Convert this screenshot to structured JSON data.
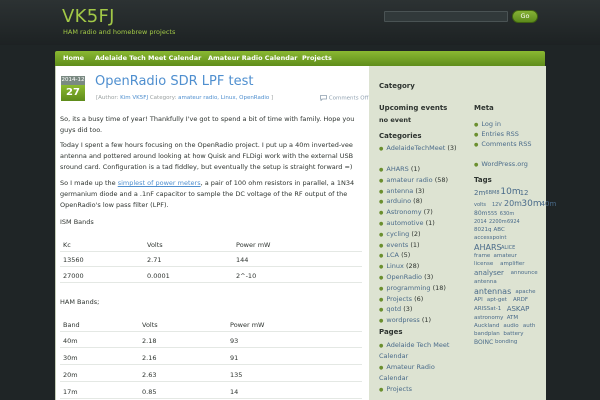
{
  "header": {
    "site_title": "VK5FJ",
    "tagline": "HAM radio and homebrew projects",
    "search_button": "Go"
  },
  "nav": {
    "items": [
      "Home",
      "Adelaide Tech Meet Calendar",
      "Amateur Radio Calendar",
      "Projects"
    ]
  },
  "post": {
    "date_month": "2014-12",
    "date_day": "27",
    "title": "OpenRadio SDR LPF test",
    "meta_author_prefix": "[Author: ",
    "meta_author": "Kim VK5FJ",
    "meta_category_prefix": " Category: ",
    "meta_categories": "amateur radio, Linux, OpenRadio",
    "meta_suffix": " ]",
    "comments": "Comments Off",
    "p1": "So, its a busy time of year! Thankfully I've got to spend a bit of time with family. Hope you guys did too.",
    "p2": "Today I spent a few hours focusing on the OpenRadio project. I put up a 40m inverted-vee antenna and pottered around looking at how Quisk and FLDigi work with the external USB sround card. Configuration is a tad fiddley, but eventually the setup is straight forward =)",
    "p3_before": "So I made up the ",
    "p3_link": "simplest of power meters",
    "p3_after": ", a pair of 100 ohm resistors in parallel, a 1N34 germanium diode and a .1nF capacitor to sample the DC voltage of the RF output of the OpenRadio's low pass filter (LPF).",
    "ism_label": "ISM Bands",
    "ism_headers": [
      "Kc",
      "Volts",
      "Power mW"
    ],
    "ism_rows": [
      [
        "13560",
        "2.71",
        "144"
      ],
      [
        "27000",
        "0.0001",
        "2^-10"
      ]
    ],
    "ham_label": "HAM Bands;",
    "ham_headers": [
      "Band",
      "Volts",
      "Power mW"
    ],
    "ham_rows": [
      [
        "40m",
        "2.18",
        "93"
      ],
      [
        "30m",
        "2.16",
        "91"
      ],
      [
        "20m",
        "2.63",
        "135"
      ],
      [
        "17m",
        "0.85",
        "14"
      ]
    ]
  },
  "sidebar": {
    "category_title": "Category",
    "upcoming_title": "Upcoming events",
    "no_event": "no event",
    "meta_title": "Meta",
    "meta_links": [
      "Log in",
      "Entries RSS",
      "Comments RSS",
      "WordPress.org"
    ],
    "categories_title": "Categories",
    "categories": [
      {
        "name": "AdelaideTechMeet",
        "count": "(3)"
      },
      {
        "name": "AHARS",
        "count": "(1)"
      },
      {
        "name": "amateur radio",
        "count": "(58)"
      },
      {
        "name": "antenna",
        "count": "(3)"
      },
      {
        "name": "arduino",
        "count": "(8)"
      },
      {
        "name": "Astronomy",
        "count": "(7)"
      },
      {
        "name": "automotive",
        "count": "(1)"
      },
      {
        "name": "cycling",
        "count": "(2)"
      },
      {
        "name": "events",
        "count": "(1)"
      },
      {
        "name": "LCA",
        "count": "(5)"
      },
      {
        "name": "Linux",
        "count": "(28)"
      },
      {
        "name": "OpenRadio",
        "count": "(3)"
      },
      {
        "name": "programming",
        "count": "(18)"
      },
      {
        "name": "Projects",
        "count": "(6)"
      },
      {
        "name": "qotd",
        "count": "(3)"
      },
      {
        "name": "wordpress",
        "count": "(1)"
      }
    ],
    "tags_title": "Tags",
    "tag_lines": [
      [
        {
          "t": "2m",
          "s": 7
        },
        {
          "t": "6BM8",
          "s": 5
        },
        {
          "t": "10m",
          "s": 9
        },
        {
          "t": "12",
          "s": 7
        }
      ],
      [
        {
          "t": "volts",
          "s": 5
        },
        {
          "t": "12V",
          "s": 5
        },
        {
          "t": "20m",
          "s": 8
        },
        {
          "t": "30m",
          "s": 9
        },
        {
          "t": "40m",
          "s": 7
        }
      ],
      [
        {
          "t": "80m",
          "s": 6
        },
        {
          "t": "555",
          "s": 5
        },
        {
          "t": "630m",
          "s": 5
        }
      ],
      [
        {
          "t": "2014",
          "s": 5
        },
        {
          "t": "2200m",
          "s": 5
        },
        {
          "t": "6924",
          "s": 5
        }
      ],
      [
        {
          "t": "8021q",
          "s": 5.5
        },
        {
          "t": "ABC",
          "s": 5.5
        }
      ],
      [
        {
          "t": "accesspoint",
          "s": 5.5
        }
      ],
      [
        {
          "t": "AHARS",
          "s": 8
        },
        {
          "t": "ALICE",
          "s": 5
        }
      ],
      [
        {
          "t": "frame",
          "s": 5.5
        },
        {
          "t": "amateur",
          "s": 5.5
        }
      ],
      [
        {
          "t": "license",
          "s": 5.5
        },
        {
          "t": "amplifier",
          "s": 5.5
        }
      ],
      [
        {
          "t": "analyser",
          "s": 7
        },
        {
          "t": "announce",
          "s": 5.5
        }
      ],
      [
        {
          "t": "antenna",
          "s": 5.5
        }
      ],
      [
        {
          "t": "antennas",
          "s": 8
        },
        {
          "t": "apache",
          "s": 5.5
        }
      ],
      [
        {
          "t": "API",
          "s": 5.5
        },
        {
          "t": "apt-get",
          "s": 5.5
        },
        {
          "t": "ARDF",
          "s": 5.5
        }
      ],
      [
        {
          "t": "ARISSat-1",
          "s": 5.5
        },
        {
          "t": "ASKAP",
          "s": 7
        }
      ],
      [
        {
          "t": "astronomy",
          "s": 5.5
        },
        {
          "t": "ATM",
          "s": 5.5
        }
      ],
      [
        {
          "t": "Auckland",
          "s": 5.5
        },
        {
          "t": "audio",
          "s": 5.5
        },
        {
          "t": "auth",
          "s": 5.5
        }
      ],
      [
        {
          "t": "bandplan",
          "s": 5.5
        },
        {
          "t": "battery",
          "s": 5.5
        }
      ],
      [
        {
          "t": "BOINC",
          "s": 6
        },
        {
          "t": "bonding",
          "s": 5.5
        }
      ]
    ],
    "pages_title": "Pages",
    "pages": [
      "Adelaide Tech Meet Calendar",
      "Amateur Radio Calendar",
      "Projects"
    ]
  }
}
